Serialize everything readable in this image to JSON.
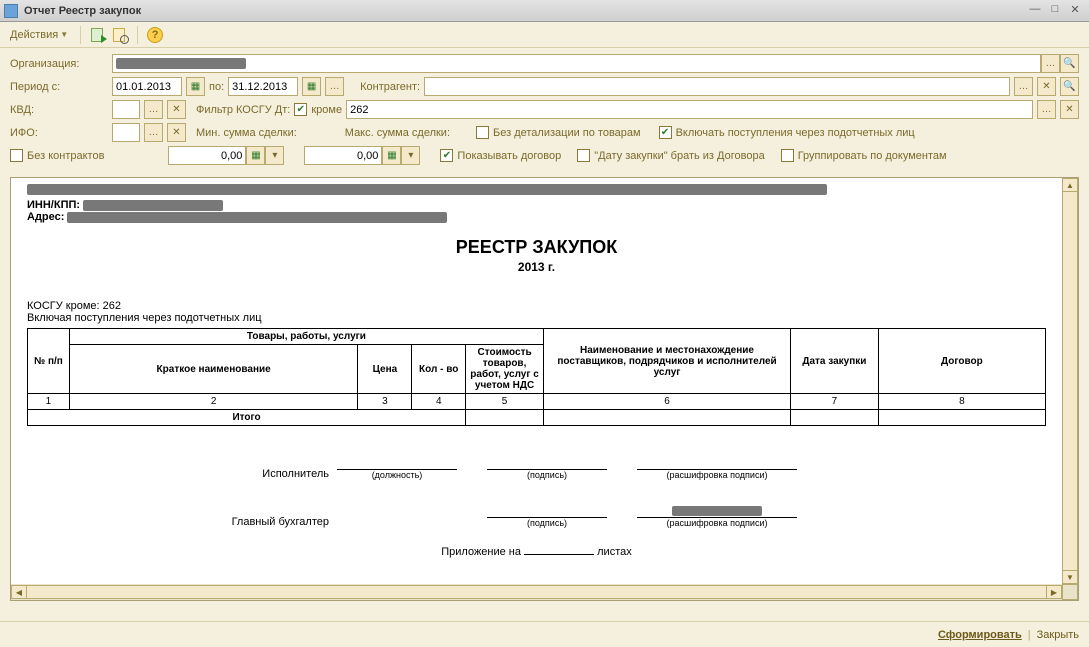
{
  "window": {
    "title": "Отчет  Реестр закупок"
  },
  "toolbar": {
    "actions_label": "Действия"
  },
  "filters": {
    "org_label": "Организация:",
    "period_label": "Период с:",
    "period_from": "01.01.2013",
    "period_to_label": "по:",
    "period_to": "31.12.2013",
    "contragent_label": "Контрагент:",
    "kvd_label": "КВД:",
    "kosgu_filter_label": "Фильтр КОСГУ Дт:",
    "krome_label": "кроме",
    "kosgu_value": "262",
    "ifo_label": "ИФО:",
    "min_sum_label": "Мин. сумма сделки:",
    "max_sum_label": "Макс. сумма сделки:",
    "no_detail_label": "Без детализации по товарам",
    "include_accountable_label": "Включать поступления через подотчетных лиц",
    "no_contracts_label": "Без контрактов",
    "num1": "0,00",
    "num2": "0,00",
    "show_contract_label": "Показывать договор",
    "date_from_contract_label": "\"Дату закупки\" брать из Договора",
    "group_by_docs_label": "Группировать по документам"
  },
  "report": {
    "inn_label": "ИНН/КПП:",
    "addr_label": "Адрес:",
    "title": "РЕЕСТР ЗАКУПОК",
    "year": "2013 г.",
    "kosgu_note": "КОСГУ кроме: 262",
    "include_note": "Включая поступления через подотчетных лиц",
    "headers": {
      "np": "№ п/п",
      "goods_group": "Товары, работы, услуги",
      "short_name": "Краткое наименование",
      "price": "Цена",
      "qty": "Кол - во",
      "cost_vat": "Стоимость товаров, работ, услуг с учетом НДС",
      "supplier": "Наименование и местонахождение поставщиков, подрядчиков и исполнителей услуг",
      "date": "Дата закупки",
      "contract": "Договор"
    },
    "col_nums": [
      "1",
      "2",
      "3",
      "4",
      "5",
      "6",
      "7",
      "8"
    ],
    "total_label": "Итого",
    "sig": {
      "executor": "Исполнитель",
      "position": "(должность)",
      "signature": "(подпись)",
      "decipher": "(расшифровка подписи)",
      "chief_acc": "Главный бухгалтер",
      "appendix_on": "Приложение на",
      "sheets": "листах"
    }
  },
  "footer": {
    "form": "Сформировать",
    "close": "Закрыть"
  }
}
